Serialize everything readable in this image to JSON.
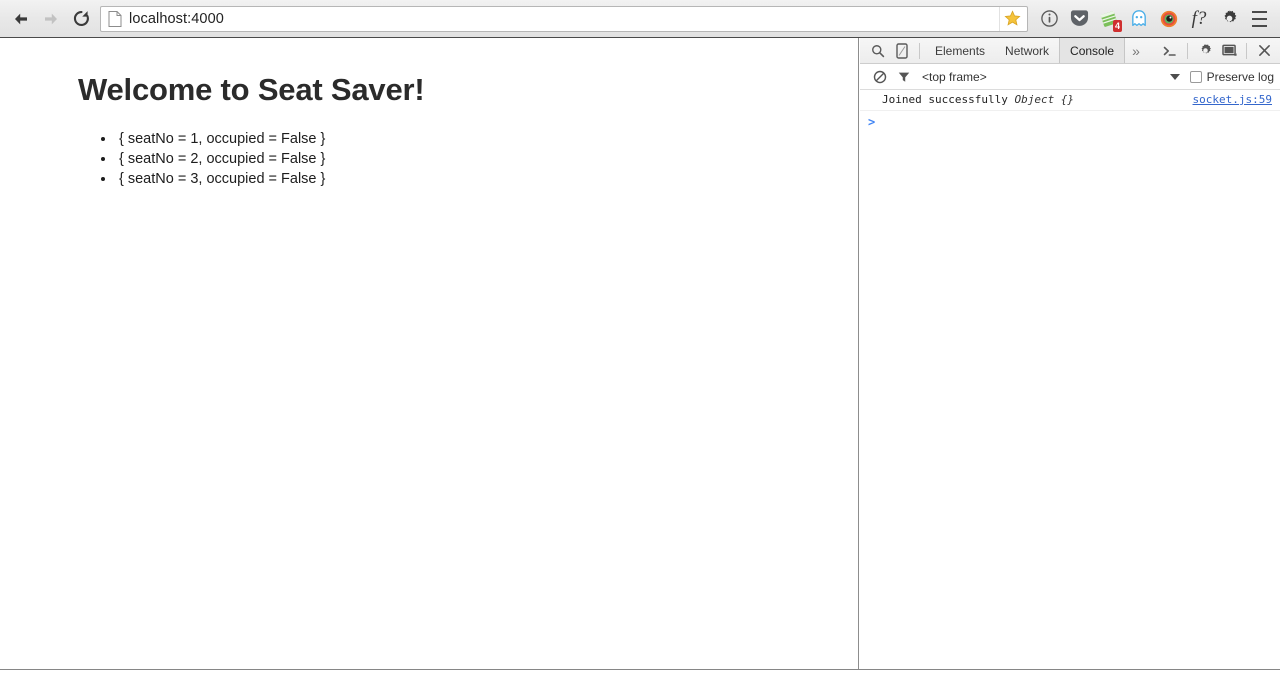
{
  "browser": {
    "back_label": "Back",
    "forward_label": "Forward",
    "reload_label": "Reload",
    "url_display": "localhost:4000",
    "url_host": "localhost",
    "url_port": ":4000",
    "star_label": "Bookmark this page",
    "icons": [
      {
        "name": "page-info-icon",
        "label": "Page info"
      },
      {
        "name": "pocket-icon",
        "label": "Save to Pocket"
      },
      {
        "name": "evernote-icon",
        "label": "Evernote Web Clipper",
        "badge": "4"
      },
      {
        "name": "ghostery-icon",
        "label": "Ghostery"
      },
      {
        "name": "extension-circle-icon",
        "label": "Extension"
      },
      {
        "name": "fq-icon",
        "label": "f?"
      },
      {
        "name": "gear-icon",
        "label": "Settings"
      },
      {
        "name": "menu-icon",
        "label": "Chrome menu"
      }
    ],
    "accent_star_color": "#f5c33b"
  },
  "page": {
    "title": "Welcome to Seat Saver!",
    "seats": [
      "{ seatNo = 1, occupied = False }",
      "{ seatNo = 2, occupied = False }",
      "{ seatNo = 3, occupied = False }"
    ]
  },
  "devtools": {
    "toolbar": {
      "search_label": "Search",
      "device_toggle_label": "Toggle device toolbar",
      "tabs": [
        {
          "label": "Elements",
          "active": false
        },
        {
          "label": "Network",
          "active": false
        },
        {
          "label": "Console",
          "active": true
        }
      ],
      "more_tabs_label": "»",
      "console_drawer_label": ">_",
      "settings_label": "Settings",
      "dock_label": "Dock side",
      "close_label": "×"
    },
    "filterbar": {
      "clear_label": "Clear console",
      "filter_label": "Filter",
      "frame": "<top frame>",
      "preserve_log_label": "Preserve log",
      "preserve_log_checked": false
    },
    "console": {
      "messages": [
        {
          "text": "Joined successfully ",
          "object": "Object {}",
          "source": "socket.js:59"
        }
      ],
      "prompt": ">"
    }
  }
}
